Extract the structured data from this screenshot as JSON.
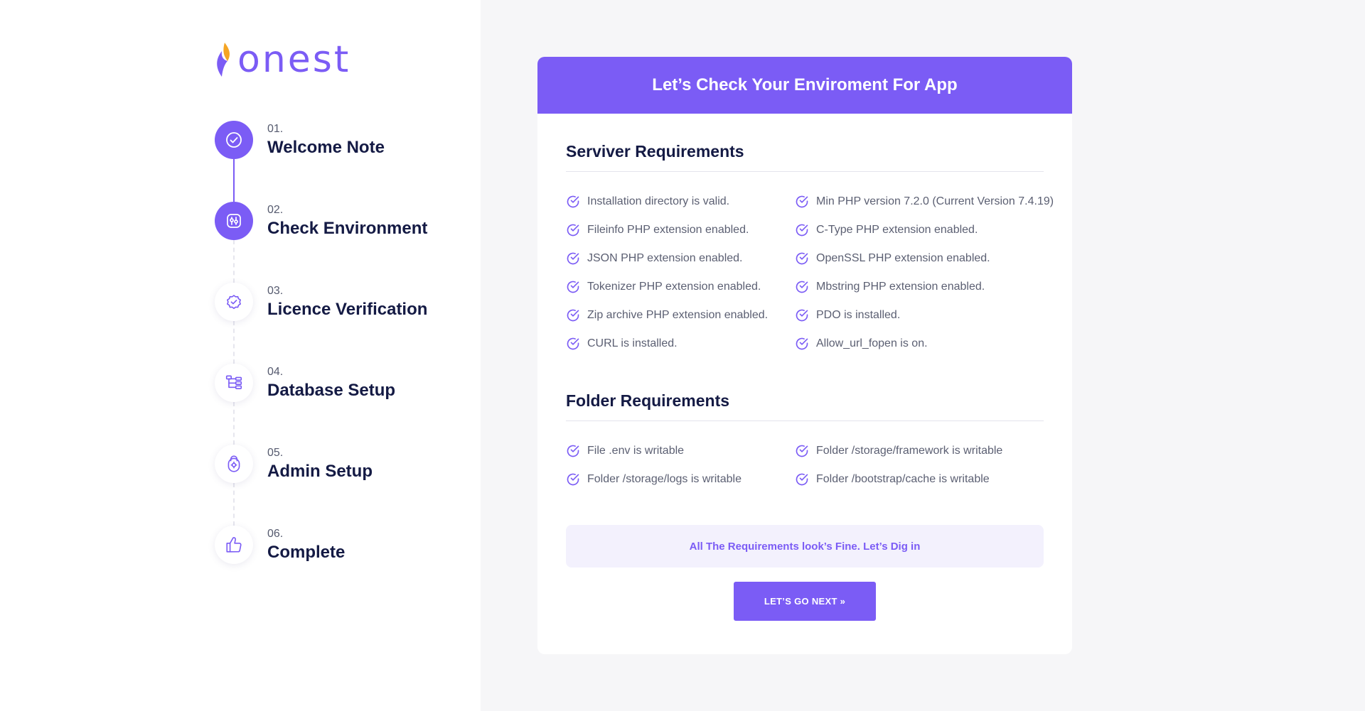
{
  "brand": {
    "name": "onest",
    "flame_color": "#f5a524",
    "accent": "#7b5cf5"
  },
  "steps": [
    {
      "number": "01.",
      "title": "Welcome Note",
      "state": "done",
      "icon": "check-circle-icon"
    },
    {
      "number": "02.",
      "title": "Check Environment",
      "state": "active",
      "icon": "sliders-icon"
    },
    {
      "number": "03.",
      "title": "Licence Verification",
      "state": "pending",
      "icon": "badge-check-icon"
    },
    {
      "number": "04.",
      "title": "Database Setup",
      "state": "pending",
      "icon": "hierarchy-icon"
    },
    {
      "number": "05.",
      "title": "Admin Setup",
      "state": "pending",
      "icon": "user-settings-icon"
    },
    {
      "number": "06.",
      "title": "Complete",
      "state": "pending",
      "icon": "thumbs-up-icon"
    }
  ],
  "card": {
    "title": "Let’s Check Your Enviroment For App",
    "server_title": "Serviver Requirements",
    "server_items": [
      "Installation directory is valid.",
      "Min PHP version 7.2.0 (Current Version 7.4.19)",
      "Fileinfo PHP extension enabled.",
      "C-Type PHP extension enabled.",
      "JSON PHP extension enabled.",
      "OpenSSL PHP extension enabled.",
      "Tokenizer PHP extension enabled.",
      "Mbstring PHP extension enabled.",
      "Zip archive PHP extension enabled.",
      "PDO is installed.",
      "CURL is installed.",
      "Allow_url_fopen is on."
    ],
    "folder_title": "Folder Requirements",
    "folder_items": [
      "File .env is writable",
      "Folder /storage/framework is writable",
      "Folder /storage/logs is writable",
      "Folder /bootstrap/cache is writable"
    ],
    "notice": "All The Requirements look’s Fine. Let’s Dig in",
    "next_button": "LET’S GO NEXT »"
  }
}
